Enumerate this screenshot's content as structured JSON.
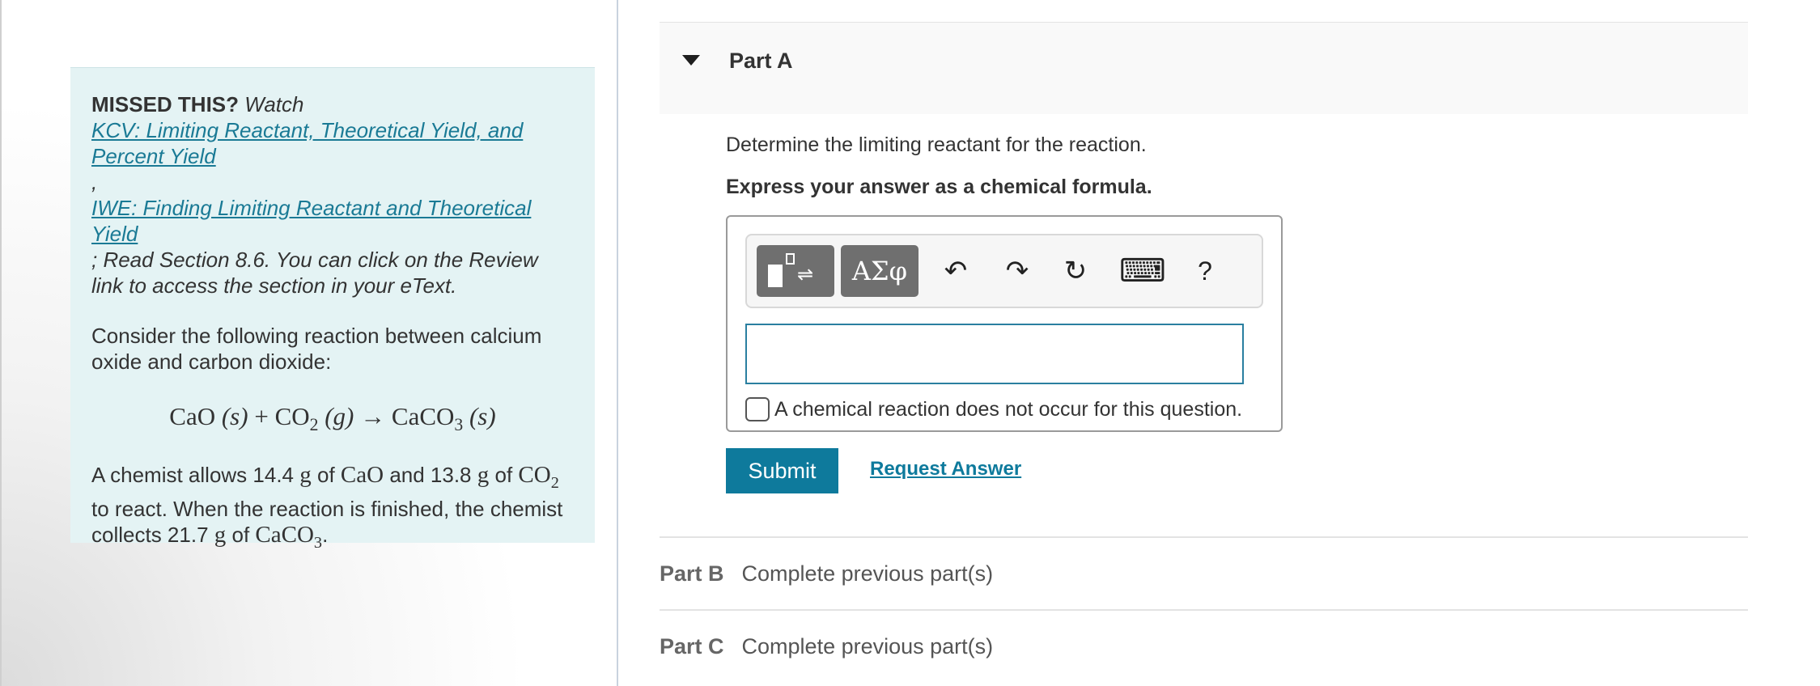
{
  "sidebar": {
    "missed_label": "MISSED THIS?",
    "watch_label": "Watch",
    "link1": "KCV: Limiting Reactant, Theoretical Yield, and Percent Yield",
    "separator": ",",
    "link2": "IWE: Finding Limiting Reactant and Theoretical Yield",
    "read_text": "; Read Section 8.6. You can click on the Review link to access the section in your eText.",
    "consider_text": "Consider the following reaction between calcium oxide and carbon dioxide:",
    "equation": {
      "cao": "CaO",
      "state_s": "(s)",
      "plus": "+",
      "co": "CO",
      "sub2": "2",
      "state_g": "(g)",
      "arrow": "→",
      "caco": "CaCO",
      "sub3": "3"
    },
    "problem": {
      "p1": "A chemist allows 14.4",
      "g": "g",
      "of": "of",
      "cao": "CaO",
      "and": "and 13.8",
      "co": "CO",
      "sub2": "2",
      "react": "to react. When the reaction is finished, the chemist collects 21.7",
      "caco": "CaCO",
      "sub3": "3",
      "period": "."
    }
  },
  "part_a": {
    "title": "Part A",
    "question": "Determine the limiting reactant for the reaction.",
    "instruction": "Express your answer as a chemical formula.",
    "toolbar": {
      "templates_icon": "templates-icon",
      "greek_label": "ΑΣφ",
      "undo": "↶",
      "redo": "↷",
      "reset": "↻",
      "keyboard": "⌨",
      "help": "?"
    },
    "answer_value": "",
    "no_reaction_label": "A chemical reaction does not occur for this question.",
    "submit_label": "Submit",
    "request_label": "Request Answer"
  },
  "parts": [
    {
      "label": "Part B",
      "status": "Complete previous part(s)"
    },
    {
      "label": "Part C",
      "status": "Complete previous part(s)"
    }
  ],
  "colors": {
    "accent": "#0e7a9c",
    "sidebar_bg": "#e4f3f4",
    "link": "#1a7a95"
  }
}
